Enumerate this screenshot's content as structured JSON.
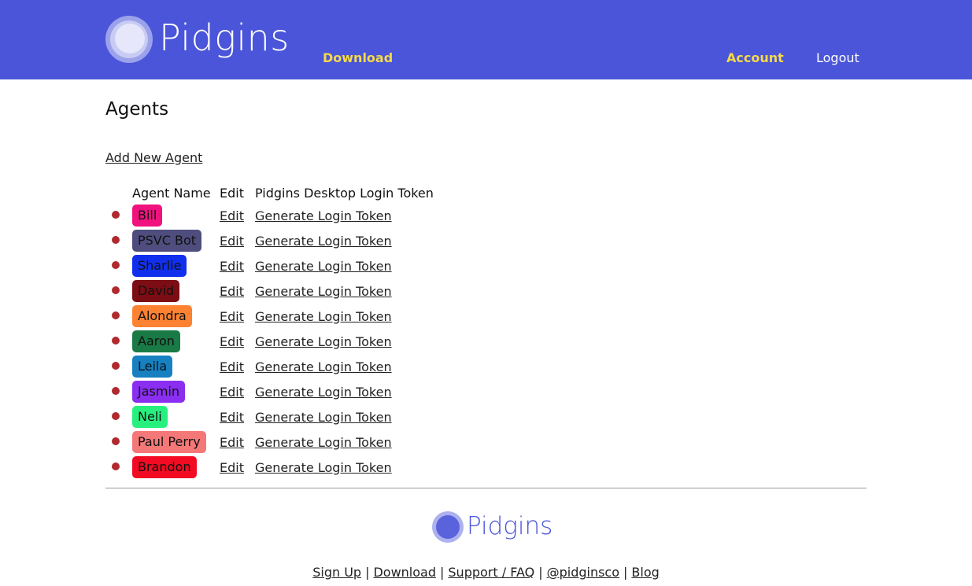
{
  "brand": {
    "name": "Pidgins",
    "logo_icon": "pidgins-circle-logo-icon"
  },
  "nav": {
    "download": "Download",
    "account": "Account",
    "logout": "Logout",
    "accent_color": "#f5d94a",
    "header_color": "#4a55d9"
  },
  "page": {
    "title": "Agents",
    "add_agent": "Add New Agent"
  },
  "table": {
    "headers": {
      "name": "Agent Name",
      "edit": "Edit",
      "token": "Pidgins Desktop Login Token"
    },
    "status_dot_color": "#b0292d",
    "rows": [
      {
        "name": "Bill",
        "color": "#f0127e",
        "edit": "Edit",
        "token": "Generate Login Token"
      },
      {
        "name": "PSVC Bot",
        "color": "#4f4d7d",
        "edit": "Edit",
        "token": "Generate Login Token"
      },
      {
        "name": "Sharlie",
        "color": "#1030ee",
        "edit": "Edit",
        "token": "Generate Login Token"
      },
      {
        "name": "David",
        "color": "#7c0d14",
        "edit": "Edit",
        "token": "Generate Login Token"
      },
      {
        "name": "Alondra",
        "color": "#fd8232",
        "edit": "Edit",
        "token": "Generate Login Token"
      },
      {
        "name": "Aaron",
        "color": "#1a7a45",
        "edit": "Edit",
        "token": "Generate Login Token"
      },
      {
        "name": "Leila",
        "color": "#1680c1",
        "edit": "Edit",
        "token": "Generate Login Token"
      },
      {
        "name": "Jasmin",
        "color": "#8a2ef0",
        "edit": "Edit",
        "token": "Generate Login Token"
      },
      {
        "name": "Neli",
        "color": "#28f07e",
        "edit": "Edit",
        "token": "Generate Login Token"
      },
      {
        "name": "Paul Perry",
        "color": "#f57878",
        "edit": "Edit",
        "token": "Generate Login Token"
      },
      {
        "name": "Brandon",
        "color": "#f20b22",
        "edit": "Edit",
        "token": "Generate Login Token"
      }
    ]
  },
  "footer": {
    "brand": "Pidgins",
    "links": [
      "Sign Up",
      "Download",
      "Support / FAQ",
      "@pidginsco",
      "Blog"
    ],
    "separator": "|"
  }
}
